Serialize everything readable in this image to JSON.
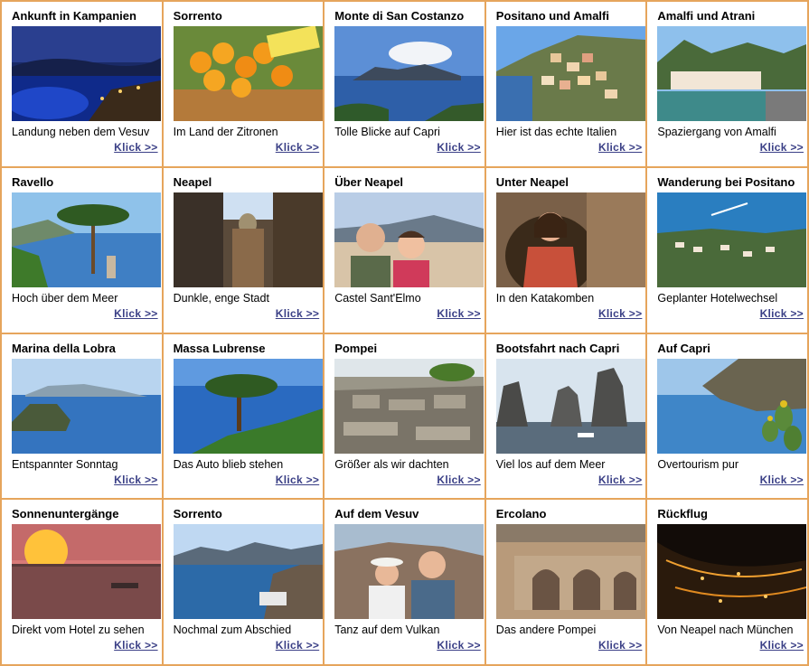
{
  "link_label": "Klick  >>",
  "tiles": [
    {
      "title": "Ankunft in Kampanien",
      "caption": "Landung neben dem Vesuv",
      "scene": "night-coast"
    },
    {
      "title": "Sorrento",
      "caption": "Im Land der Zitronen",
      "scene": "lemons"
    },
    {
      "title": "Monte di San Costanzo",
      "caption": "Tolle Blicke auf Capri",
      "scene": "island-view"
    },
    {
      "title": "Positano und Amalfi",
      "caption": "Hier ist das echte Italien",
      "scene": "cliff-town"
    },
    {
      "title": "Amalfi und Atrani",
      "caption": "Spaziergang von Amalfi",
      "scene": "harbor-town"
    },
    {
      "title": "Ravello",
      "caption": "Hoch über dem Meer",
      "scene": "pine-sea"
    },
    {
      "title": "Neapel",
      "caption": "Dunkle, enge Stadt",
      "scene": "narrow-street"
    },
    {
      "title": "Über Neapel",
      "caption": "Castel Sant'Elmo",
      "scene": "selfie-city"
    },
    {
      "title": "Unter Neapel",
      "caption": "In den Katakomben",
      "scene": "catacomb"
    },
    {
      "title": "Wanderung bei Positano",
      "caption": "Geplanter Hotelwechsel",
      "scene": "aerial-coast"
    },
    {
      "title": "Marina della Lobra",
      "caption": "Entspannter Sonntag",
      "scene": "rock-sea"
    },
    {
      "title": "Massa Lubrense",
      "caption": "Das Auto blieb stehen",
      "scene": "pine-blue"
    },
    {
      "title": "Pompei",
      "caption": "Größer als wir dachten",
      "scene": "ruins"
    },
    {
      "title": "Bootsfahrt nach Capri",
      "caption": "Viel los auf dem Meer",
      "scene": "faraglioni"
    },
    {
      "title": "Auf Capri",
      "caption": "Overtourism pur",
      "scene": "cactus-sea"
    },
    {
      "title": "Sonnenuntergänge",
      "caption": "Direkt vom Hotel zu sehen",
      "scene": "sunset"
    },
    {
      "title": "Sorrento",
      "caption": "Nochmal zum Abschied",
      "scene": "bay-port"
    },
    {
      "title": "Auf dem Vesuv",
      "caption": "Tanz auf dem Vulkan",
      "scene": "selfie-volcano"
    },
    {
      "title": "Ercolano",
      "caption": "Das andere Pompei",
      "scene": "arches"
    },
    {
      "title": "Rückflug",
      "caption": "Von Neapel nach München",
      "scene": "night-lights"
    }
  ]
}
